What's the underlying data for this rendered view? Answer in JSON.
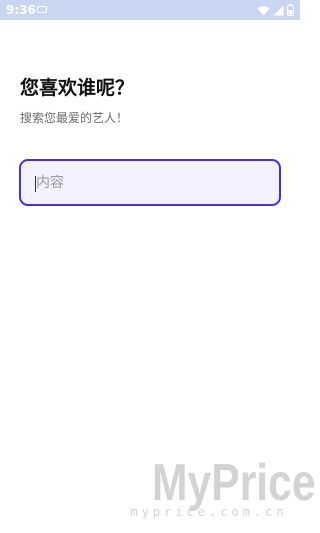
{
  "status_bar": {
    "time": "9:36",
    "icons": [
      "notification-icon",
      "wifi-icon",
      "signal-icon",
      "battery-icon"
    ],
    "background_color": "#c9d6f2"
  },
  "header": {
    "title": "您喜欢谁呢？",
    "subtitle": "搜索您最爱的艺人！"
  },
  "search": {
    "placeholder": "内容",
    "value": "",
    "border_color": "#4a2fd3",
    "background_color": "#f3f0ff"
  },
  "watermark": {
    "logo": "MyPrice",
    "url": "myprice.com.cn"
  }
}
